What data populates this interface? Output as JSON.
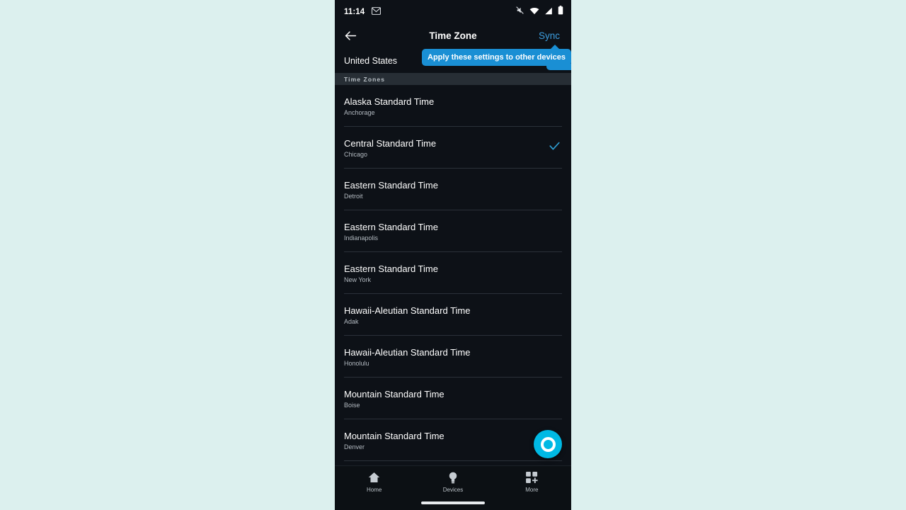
{
  "device": {
    "background_color": "#dcf0ee",
    "screen_background": "#0d1117"
  },
  "status_bar": {
    "time": "11:14",
    "left_icons": [
      {
        "name": "gmail-icon",
        "label": "Gmail notification"
      }
    ],
    "right_icons": [
      {
        "name": "ringer-mute-icon",
        "label": "Silent mode"
      },
      {
        "name": "wifi-icon",
        "label": "Wi-Fi"
      },
      {
        "name": "cellular-signal-icon",
        "label": "Cellular signal"
      },
      {
        "name": "battery-icon",
        "label": "Battery"
      }
    ]
  },
  "app_bar": {
    "back_label": "Back",
    "title": "Time Zone",
    "sync_label": "Sync",
    "sync_color": "#3d9fe0"
  },
  "country": {
    "label": "United States"
  },
  "tooltip": {
    "text": "Apply these settings to other devices",
    "background_color": "#1a8fd4",
    "text_color": "#ffffff"
  },
  "section": {
    "header": "Time Zones",
    "header_background": "#272e35"
  },
  "time_zones": [
    {
      "name": "Alaska Standard Time",
      "city": "Anchorage",
      "selected": false
    },
    {
      "name": "Central Standard Time",
      "city": "Chicago",
      "selected": true
    },
    {
      "name": "Eastern Standard Time",
      "city": "Detroit",
      "selected": false
    },
    {
      "name": "Eastern Standard Time",
      "city": "Indianapolis",
      "selected": false
    },
    {
      "name": "Eastern Standard Time",
      "city": "New York",
      "selected": false
    },
    {
      "name": "Hawaii-Aleutian Standard Time",
      "city": "Adak",
      "selected": false
    },
    {
      "name": "Hawaii-Aleutian Standard Time",
      "city": "Honolulu",
      "selected": false
    },
    {
      "name": "Mountain Standard Time",
      "city": "Boise",
      "selected": false
    },
    {
      "name": "Mountain Standard Time",
      "city": "Denver",
      "selected": false
    }
  ],
  "selection": {
    "check_color": "#2e9fd4"
  },
  "alexa_button": {
    "label": "Alexa",
    "color": "#00b9e4"
  },
  "bottom_nav": {
    "items": [
      {
        "icon": "home-icon",
        "label": "Home",
        "active": false
      },
      {
        "icon": "lightbulb-icon",
        "label": "Devices",
        "active": true
      },
      {
        "icon": "grid-plus-icon",
        "label": "More",
        "active": false
      }
    ]
  }
}
